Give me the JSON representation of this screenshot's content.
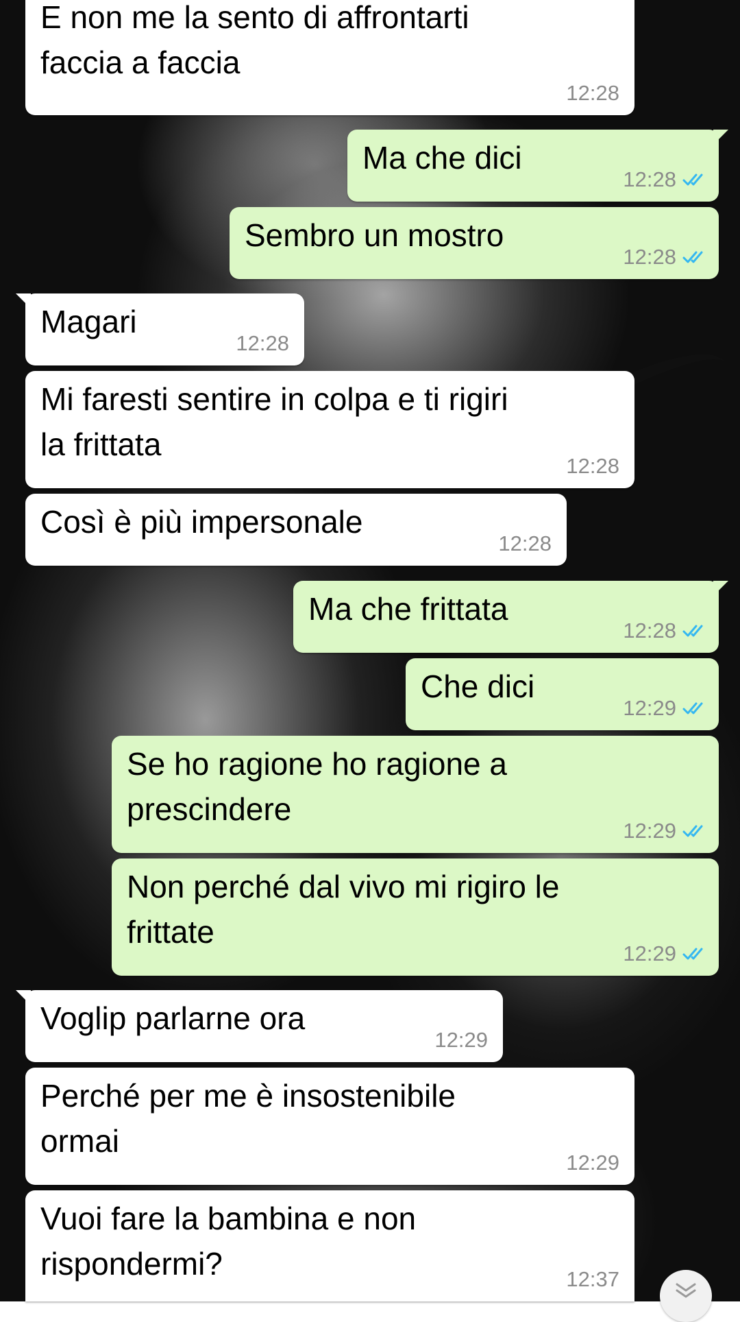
{
  "messages": [
    {
      "direction": "in",
      "text": "E non me la sento di affrontarti\nfaccia a faccia",
      "time": "12:28"
    },
    {
      "direction": "out",
      "text": "Ma che dici",
      "time": "12:28",
      "read": true
    },
    {
      "direction": "out",
      "text": "Sembro un mostro",
      "time": "12:28",
      "read": true
    },
    {
      "direction": "in",
      "text": "Magari",
      "time": "12:28"
    },
    {
      "direction": "in",
      "text": "Mi faresti sentire in colpa e ti rigiri\nla frittata",
      "time": "12:28"
    },
    {
      "direction": "in",
      "text": "Così è più impersonale",
      "time": "12:28"
    },
    {
      "direction": "out",
      "text": "Ma che frittata",
      "time": "12:28",
      "read": true
    },
    {
      "direction": "out",
      "text": "Che dici",
      "time": "12:29",
      "read": true
    },
    {
      "direction": "out",
      "text": "Se ho ragione ho ragione a\nprescindere",
      "time": "12:29",
      "read": true
    },
    {
      "direction": "out",
      "text": "Non perché dal vivo mi rigiro le\nfrittate",
      "time": "12:29",
      "read": true
    },
    {
      "direction": "in",
      "text": "Voglip parlarne ora",
      "time": "12:29"
    },
    {
      "direction": "in",
      "text": "Perché per me è insostenibile\normai",
      "time": "12:29"
    },
    {
      "direction": "in",
      "text": "Vuoi fare la bambina e non\nrispondermi?",
      "time": "12:37"
    }
  ],
  "colors": {
    "incoming_bubble": "#ffffff",
    "outgoing_bubble": "#dcf8c6",
    "timestamp": "#8a8a8a",
    "read_ticks": "#34b7f1"
  },
  "icons": {
    "read_receipt": "double-check-icon",
    "scroll_down": "double-chevron-down-icon"
  }
}
